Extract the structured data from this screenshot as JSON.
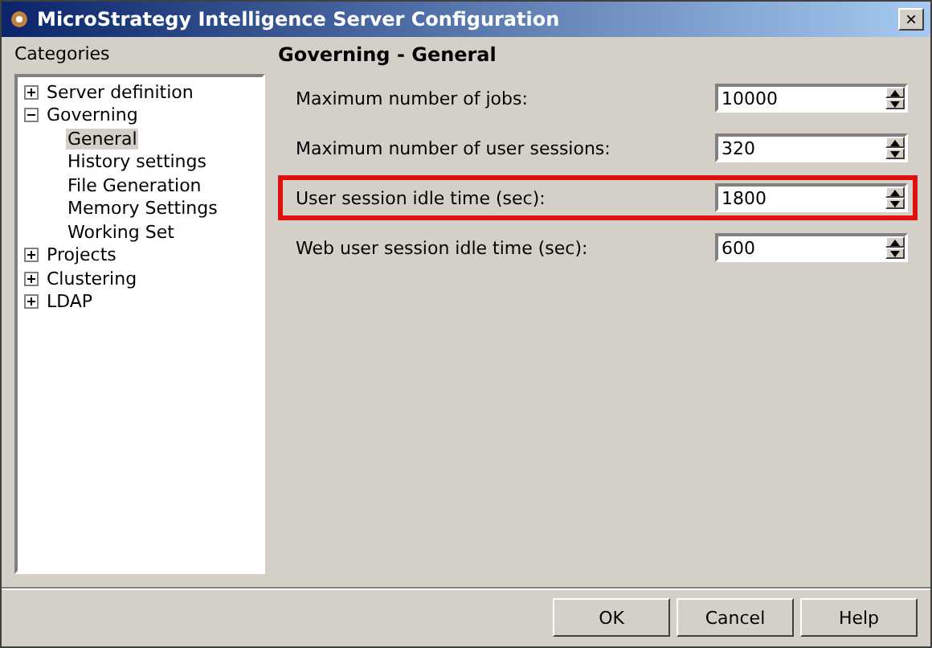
{
  "window": {
    "title": "MicroStrategy Intelligence Server Configuration",
    "close": "×"
  },
  "sidebar": {
    "title": "Categories",
    "tree": [
      {
        "label": "Server definition",
        "expanded": false,
        "selected": false
      },
      {
        "label": "Governing",
        "expanded": true,
        "selected": false,
        "children": [
          {
            "label": "General",
            "selected": true
          },
          {
            "label": "History settings",
            "selected": false
          },
          {
            "label": "File Generation",
            "selected": false
          },
          {
            "label": "Memory Settings",
            "selected": false
          },
          {
            "label": "Working Set",
            "selected": false
          }
        ]
      },
      {
        "label": "Projects",
        "expanded": false,
        "selected": false
      },
      {
        "label": "Clustering",
        "expanded": false,
        "selected": false
      },
      {
        "label": "LDAP",
        "expanded": false,
        "selected": false
      }
    ]
  },
  "panel": {
    "title": "Governing - General",
    "settings": [
      {
        "label": "Maximum number of jobs:",
        "value": "10000",
        "highlighted": false
      },
      {
        "label": "Maximum number of user sessions:",
        "value": "320",
        "highlighted": false
      },
      {
        "label": "User session idle time (sec):",
        "value": "1800",
        "highlighted": true
      },
      {
        "label": "Web user session idle time (sec):",
        "value": "600",
        "highlighted": false
      }
    ]
  },
  "buttons": [
    "OK",
    "Cancel",
    "Help"
  ]
}
